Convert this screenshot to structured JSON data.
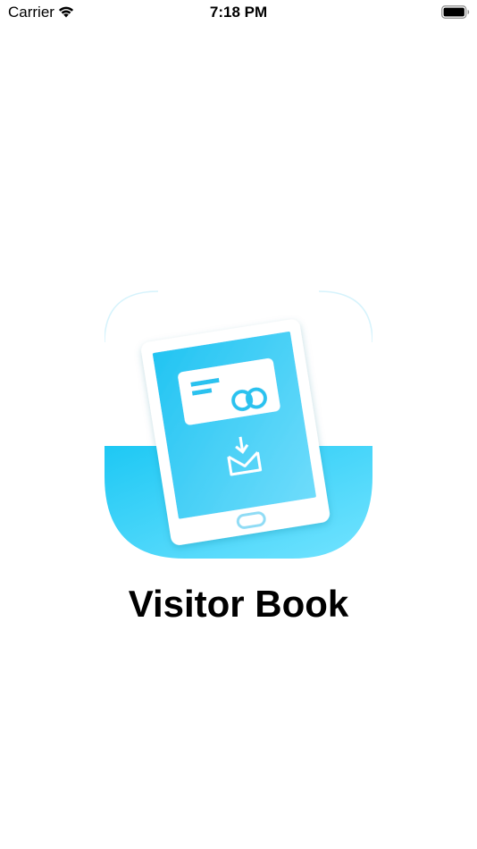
{
  "status_bar": {
    "carrier": "Carrier",
    "time": "7:18 PM",
    "wifi_icon": "wifi-icon",
    "battery_icon": "battery-icon"
  },
  "splash": {
    "app_name": "Visitor Book",
    "logo_icon": "tablet-card-mail-icon",
    "colors": {
      "accent": "#1ec8f4",
      "accent_light": "#70e0ff",
      "text": "#000000",
      "background": "#ffffff"
    }
  }
}
